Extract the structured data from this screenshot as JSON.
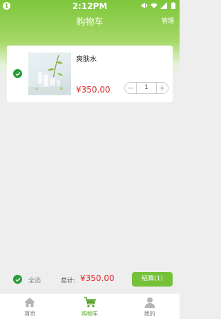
{
  "status_bar": {
    "time": "2:12PM",
    "badge": "1"
  },
  "header": {
    "title": "购物车",
    "manage_label": "管理"
  },
  "cart_item": {
    "name": "爽肤水",
    "price": "¥350.00",
    "quantity": "1",
    "minus": "−",
    "plus": "+"
  },
  "footer": {
    "select_all": "全选",
    "total_label": "总计:",
    "total_value": "¥350.00",
    "checkout_label": "结算(1)"
  },
  "tabs": [
    {
      "label": "首页",
      "icon": "home-icon",
      "active": false
    },
    {
      "label": "购物车",
      "icon": "cart-icon",
      "active": true
    },
    {
      "label": "我的",
      "icon": "profile-icon",
      "active": false
    }
  ],
  "colors": {
    "accent": "#76c13a",
    "check": "#2a9d3a",
    "price": "#d9262b"
  }
}
